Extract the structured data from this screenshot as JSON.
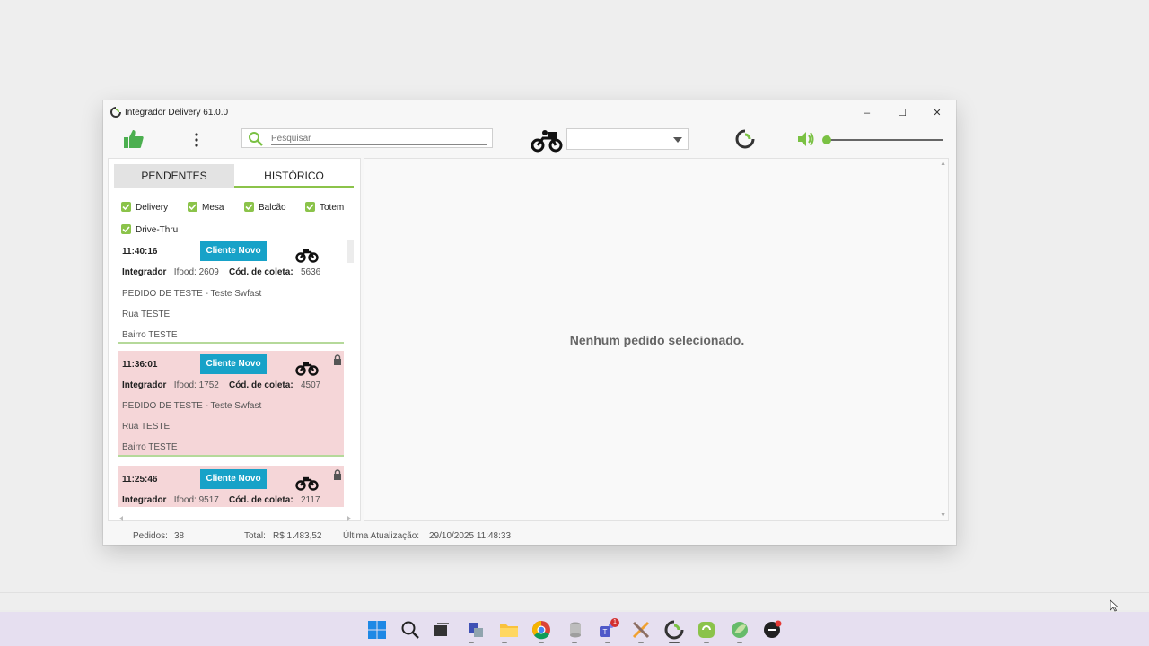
{
  "window": {
    "title": "Integrador Delivery 61.0.0",
    "minimize": "–",
    "maximize": "☐",
    "close": "✕"
  },
  "toolbar": {
    "search_placeholder": "Pesquisar",
    "select_value": ""
  },
  "tabs": [
    {
      "label": "PENDENTES",
      "active": false
    },
    {
      "label": "HISTÓRICO",
      "active": true
    }
  ],
  "filters": [
    {
      "label": "Delivery",
      "checked": true
    },
    {
      "label": "Mesa",
      "checked": true
    },
    {
      "label": "Balcão",
      "checked": true
    },
    {
      "label": "Totem",
      "checked": true
    },
    {
      "label": "Drive-Thru",
      "checked": true
    }
  ],
  "orders": [
    {
      "time": "11:40:16",
      "badge": "Cliente Novo",
      "integrador_label": "Integrador",
      "integrador_value": "Ifood: 2609",
      "coleta_label": "Cód. de coleta:",
      "coleta_value": "5636",
      "description": "PEDIDO DE TESTE - Teste Swfast",
      "street": "Rua TESTE",
      "district": "Bairro TESTE",
      "locked": false
    },
    {
      "time": "11:36:01",
      "badge": "Cliente Novo",
      "integrador_label": "Integrador",
      "integrador_value": "Ifood: 1752",
      "coleta_label": "Cód. de coleta:",
      "coleta_value": "4507",
      "description": "PEDIDO DE TESTE - Teste Swfast",
      "street": "Rua TESTE",
      "district": "Bairro TESTE",
      "locked": true
    },
    {
      "time": "11:25:46",
      "badge": "Cliente Novo",
      "integrador_label": "Integrador",
      "integrador_value": "Ifood: 9517",
      "coleta_label": "Cód. de coleta:",
      "coleta_value": "2117",
      "description": "",
      "street": "",
      "district": "",
      "locked": true
    }
  ],
  "main": {
    "empty_message": "Nenhum pedido selecionado."
  },
  "status": {
    "orders_label": "Pedidos:",
    "orders_value": "38",
    "total_label": "Total:",
    "total_value": "R$ 1.483,52",
    "update_label": "Última Atualização:",
    "update_value": "29/10/2025 11:48:33"
  },
  "taskbar": {
    "notification_count": "1"
  },
  "colors": {
    "accent_green": "#7ac143",
    "badge_blue": "#17a2c8",
    "locked_row": "#f5d6d8",
    "taskbar": "#e6dff0"
  }
}
